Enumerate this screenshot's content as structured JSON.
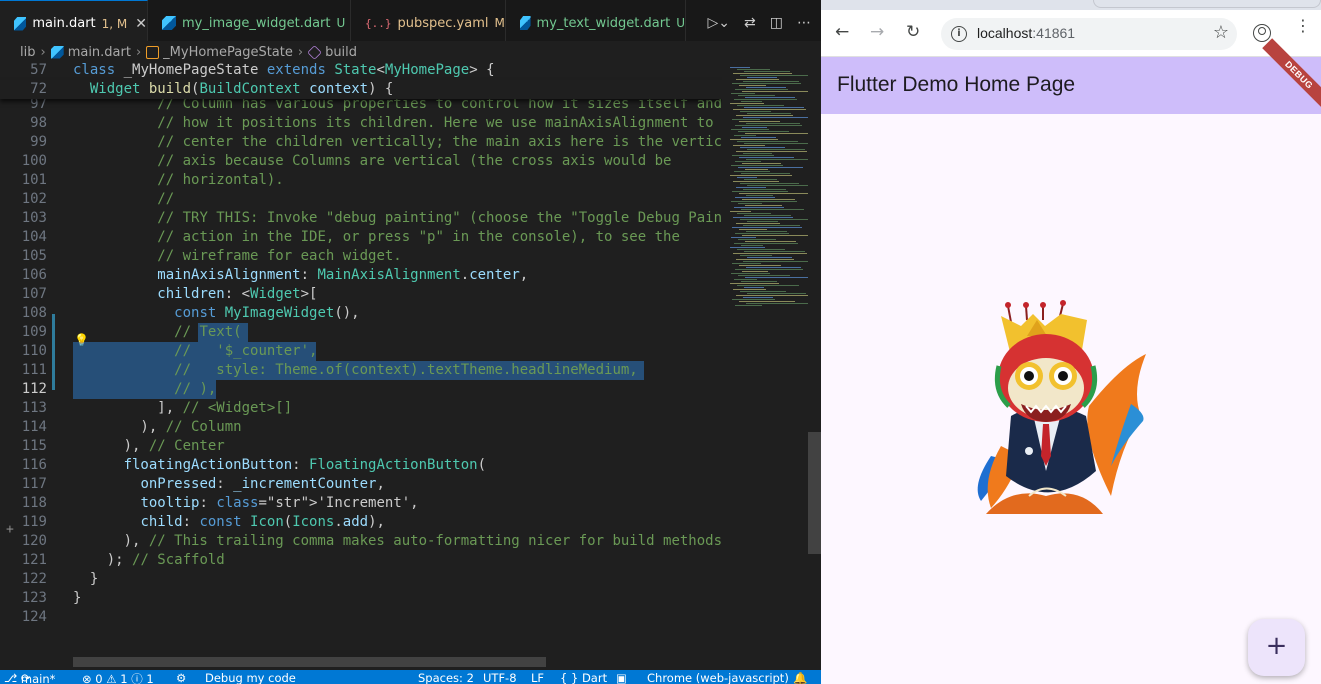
{
  "vscode": {
    "tabs": [
      {
        "label": "main.dart",
        "status": "1, M",
        "icon": "dart-icon",
        "active": true
      },
      {
        "label": "my_image_widget.dart",
        "status": "U",
        "icon": "dart-icon",
        "active": false
      },
      {
        "label": "pubspec.yaml",
        "status": "M",
        "icon": "yaml-icon",
        "active": false
      },
      {
        "label": "my_text_widget.dart",
        "status": "U",
        "icon": "dart-icon",
        "active": false
      }
    ],
    "tab_close_glyph": "✕",
    "breadcrumb": [
      "lib",
      "main.dart",
      "_MyHomePageState",
      "build"
    ],
    "code_lines": [
      {
        "n": "57",
        "text": "class _MyHomePageState extends State<MyHomePage> {"
      },
      {
        "n": "72",
        "text": "  Widget build(BuildContext context) {"
      },
      {
        "n": "97",
        "text": "          // Column has various properties to control how it sizes itself and"
      },
      {
        "n": "98",
        "text": "          // how it positions its children. Here we use mainAxisAlignment to"
      },
      {
        "n": "99",
        "text": "          // center the children vertically; the main axis here is the vertic"
      },
      {
        "n": "100",
        "text": "          // axis because Columns are vertical (the cross axis would be"
      },
      {
        "n": "101",
        "text": "          // horizontal)."
      },
      {
        "n": "102",
        "text": "          //"
      },
      {
        "n": "103",
        "text": "          // TRY THIS: Invoke \"debug painting\" (choose the \"Toggle Debug Paint"
      },
      {
        "n": "104",
        "text": "          // action in the IDE, or press \"p\" in the console), to see the"
      },
      {
        "n": "105",
        "text": "          // wireframe for each widget."
      },
      {
        "n": "106",
        "text": "          mainAxisAlignment: MainAxisAlignment.center,"
      },
      {
        "n": "107",
        "text": "          children: <Widget>["
      },
      {
        "n": "108",
        "text": "            const MyImageWidget(),"
      },
      {
        "n": "109",
        "text": "            // Text("
      },
      {
        "n": "110",
        "text": "            //   '$_counter',"
      },
      {
        "n": "111",
        "text": "            //   style: Theme.of(context).textTheme.headlineMedium,"
      },
      {
        "n": "112",
        "text": "            // ),"
      },
      {
        "n": "113",
        "text": "          ], // <Widget>[]"
      },
      {
        "n": "114",
        "text": "        ), // Column"
      },
      {
        "n": "115",
        "text": "      ), // Center"
      },
      {
        "n": "116",
        "text": "      floatingActionButton: FloatingActionButton("
      },
      {
        "n": "117",
        "text": "        onPressed: _incrementCounter,"
      },
      {
        "n": "118",
        "text": "        tooltip: 'Increment',"
      },
      {
        "n": "119",
        "text": "        child: const Icon(Icons.add),"
      },
      {
        "n": "120",
        "text": "      ), // This trailing comma makes auto-formatting nicer for build methods"
      },
      {
        "n": "121",
        "text": "    ); // Scaffold"
      },
      {
        "n": "122",
        "text": "  }"
      },
      {
        "n": "123",
        "text": "}"
      },
      {
        "n": "124",
        "text": ""
      }
    ],
    "status": {
      "branch": "main*",
      "problems": "⊗ 0 ⚠ 1 ⓘ 1",
      "debug": "Debug my code",
      "spaces": "Spaces: 2",
      "encoding": "UTF-8",
      "eol": "LF",
      "language": "{ } Dart",
      "device": "Chrome (web-javascript)"
    }
  },
  "browser": {
    "url_host": "localhost",
    "url_port": ":41861",
    "app_title": "Flutter Demo Home Page",
    "debug_banner": "DEBUG",
    "fab_label": "+",
    "fab_tooltip": "Increment",
    "nav": {
      "back": "←",
      "forward": "→",
      "reload": "↻",
      "star": "☆",
      "menu": "⋮",
      "info": "i"
    }
  }
}
